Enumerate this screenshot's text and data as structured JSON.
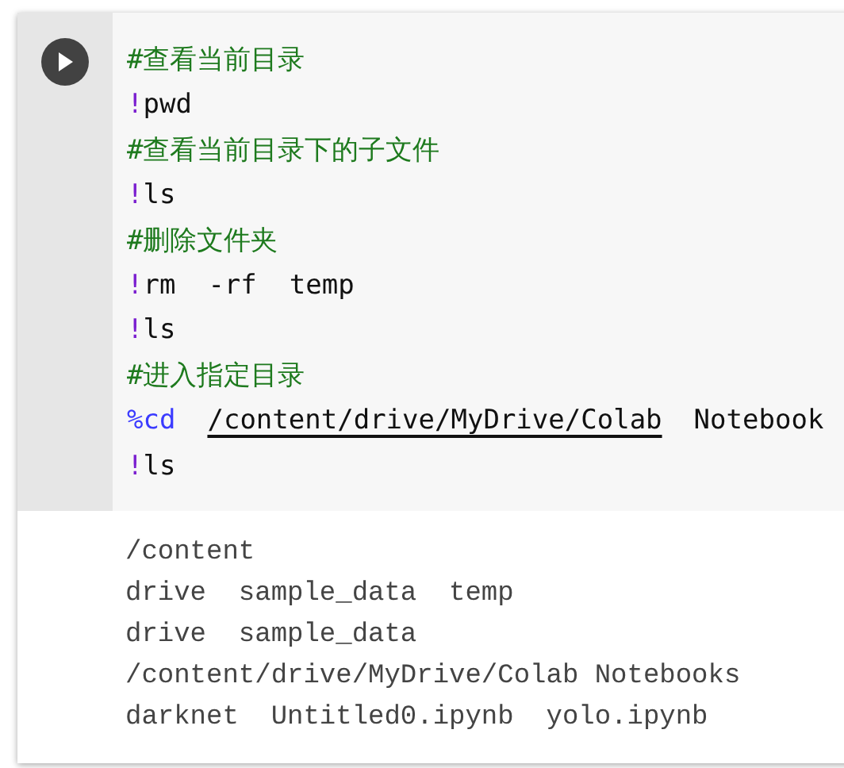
{
  "cell": {
    "code_lines": [
      {
        "kind": "comment",
        "text": "#查看当前目录"
      },
      {
        "kind": "command",
        "prefix": "!",
        "text": "pwd"
      },
      {
        "kind": "comment",
        "text": "#查看当前目录下的子文件"
      },
      {
        "kind": "command",
        "prefix": "!",
        "text": "ls"
      },
      {
        "kind": "comment",
        "text": "#删除文件夹"
      },
      {
        "kind": "command",
        "prefix": "!",
        "text": "rm  -rf  temp"
      },
      {
        "kind": "command",
        "prefix": "!",
        "text": "ls"
      },
      {
        "kind": "comment",
        "text": "#进入指定目录"
      },
      {
        "kind": "magic",
        "prefix": "%cd",
        "link": "/content/drive/MyDrive/Colab",
        "text": "Notebook"
      },
      {
        "kind": "command",
        "prefix": "!",
        "text": "ls"
      }
    ],
    "output_lines": [
      "/content",
      "drive  sample_data  temp",
      "drive  sample_data",
      "/content/drive/MyDrive/Colab Notebooks",
      "darknet  Untitled0.ipynb  yolo.ipynb"
    ]
  }
}
